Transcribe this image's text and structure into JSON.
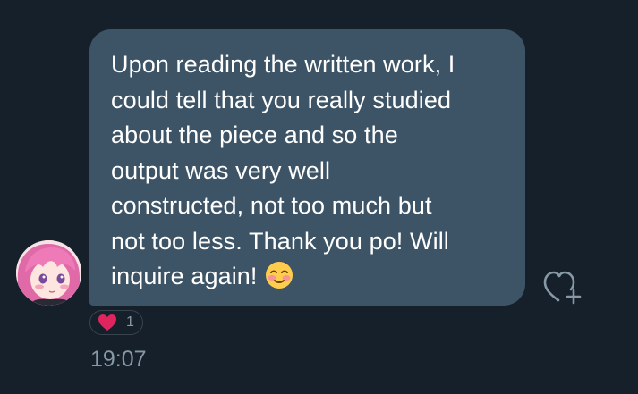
{
  "message": {
    "lines": [
      "Upon reading the written work,  I",
      "could tell that you really studied",
      "about the piece and so the",
      "output was very well",
      "constructed, not too much but",
      "not too less. Thank you po! Will",
      "inquire again!"
    ],
    "emoji": "smiling-face-with-blush"
  },
  "reaction": {
    "emoji": "red-heart",
    "count": "1"
  },
  "timestamp": "19:07",
  "react_button": {
    "icon": "heart-plus-icon"
  },
  "colors": {
    "background": "#15202b",
    "bubble": "#3d5466",
    "text": "#ffffff",
    "muted": "#8899a6",
    "heart": "#e0245e"
  }
}
